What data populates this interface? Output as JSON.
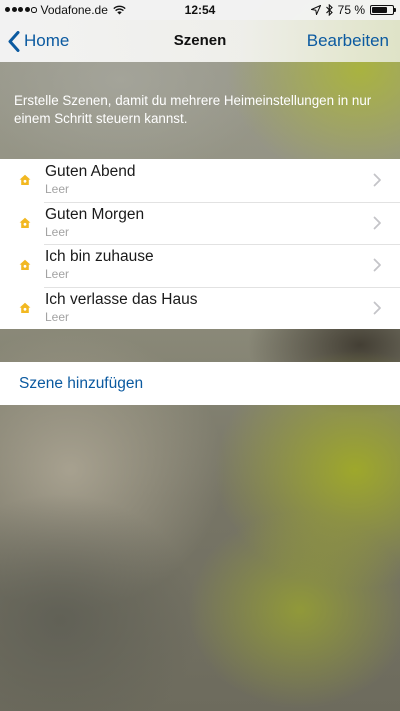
{
  "status_bar": {
    "carrier": "Vodafone.de",
    "time": "12:54",
    "battery_percent_label": "75 %",
    "battery_level": 0.75,
    "signal_bars": 4,
    "icons": [
      "signal-dots-icon",
      "wifi-icon",
      "location-arrow-icon",
      "bluetooth-icon",
      "battery-icon"
    ]
  },
  "nav": {
    "back_label": "Home",
    "title": "Szenen",
    "edit_label": "Bearbeiten"
  },
  "intro": {
    "text": "Erstelle Szenen, damit du mehrere Heimeinstellungen in nur einem Schritt steuern kannst."
  },
  "scenes": [
    {
      "name": "Guten Abend",
      "subtitle": "Leer",
      "icon": "home-scene-icon"
    },
    {
      "name": "Guten Morgen",
      "subtitle": "Leer",
      "icon": "home-scene-icon"
    },
    {
      "name": "Ich bin zuhause",
      "subtitle": "Leer",
      "icon": "home-scene-icon"
    },
    {
      "name": "Ich verlasse das Haus",
      "subtitle": "Leer",
      "icon": "home-scene-icon"
    }
  ],
  "add_scene": {
    "label": "Szene hinzufügen"
  },
  "colors": {
    "accent": "#0b5aa0",
    "scene_icon": "#f2b821",
    "subtitle": "#a3a3a3"
  }
}
